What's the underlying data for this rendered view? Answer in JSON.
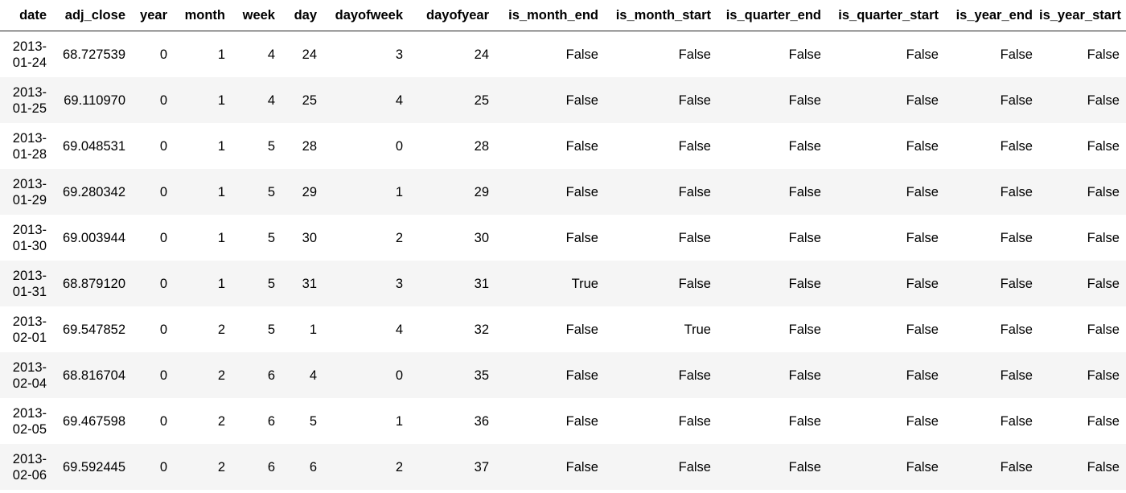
{
  "table": {
    "columns": [
      "date",
      "adj_close",
      "year",
      "month",
      "week",
      "day",
      "dayofweek",
      "dayofyear",
      "is_month_end",
      "is_month_start",
      "is_quarter_end",
      "is_quarter_start",
      "is_year_end",
      "is_year_start"
    ],
    "rows": [
      {
        "date_y": "2013-",
        "date_md": "01-24",
        "cells": [
          "68.727539",
          "0",
          "1",
          "4",
          "24",
          "3",
          "24",
          "False",
          "False",
          "False",
          "False",
          "False",
          "False"
        ]
      },
      {
        "date_y": "2013-",
        "date_md": "01-25",
        "cells": [
          "69.110970",
          "0",
          "1",
          "4",
          "25",
          "4",
          "25",
          "False",
          "False",
          "False",
          "False",
          "False",
          "False"
        ]
      },
      {
        "date_y": "2013-",
        "date_md": "01-28",
        "cells": [
          "69.048531",
          "0",
          "1",
          "5",
          "28",
          "0",
          "28",
          "False",
          "False",
          "False",
          "False",
          "False",
          "False"
        ]
      },
      {
        "date_y": "2013-",
        "date_md": "01-29",
        "cells": [
          "69.280342",
          "0",
          "1",
          "5",
          "29",
          "1",
          "29",
          "False",
          "False",
          "False",
          "False",
          "False",
          "False"
        ]
      },
      {
        "date_y": "2013-",
        "date_md": "01-30",
        "cells": [
          "69.003944",
          "0",
          "1",
          "5",
          "30",
          "2",
          "30",
          "False",
          "False",
          "False",
          "False",
          "False",
          "False"
        ]
      },
      {
        "date_y": "2013-",
        "date_md": "01-31",
        "cells": [
          "68.879120",
          "0",
          "1",
          "5",
          "31",
          "3",
          "31",
          "True",
          "False",
          "False",
          "False",
          "False",
          "False"
        ]
      },
      {
        "date_y": "2013-",
        "date_md": "02-01",
        "cells": [
          "69.547852",
          "0",
          "2",
          "5",
          "1",
          "4",
          "32",
          "False",
          "True",
          "False",
          "False",
          "False",
          "False"
        ]
      },
      {
        "date_y": "2013-",
        "date_md": "02-04",
        "cells": [
          "68.816704",
          "0",
          "2",
          "6",
          "4",
          "0",
          "35",
          "False",
          "False",
          "False",
          "False",
          "False",
          "False"
        ]
      },
      {
        "date_y": "2013-",
        "date_md": "02-05",
        "cells": [
          "69.467598",
          "0",
          "2",
          "6",
          "5",
          "1",
          "36",
          "False",
          "False",
          "False",
          "False",
          "False",
          "False"
        ]
      },
      {
        "date_y": "2013-",
        "date_md": "02-06",
        "cells": [
          "69.592445",
          "0",
          "2",
          "6",
          "6",
          "2",
          "37",
          "False",
          "False",
          "False",
          "False",
          "False",
          "False"
        ]
      }
    ]
  }
}
